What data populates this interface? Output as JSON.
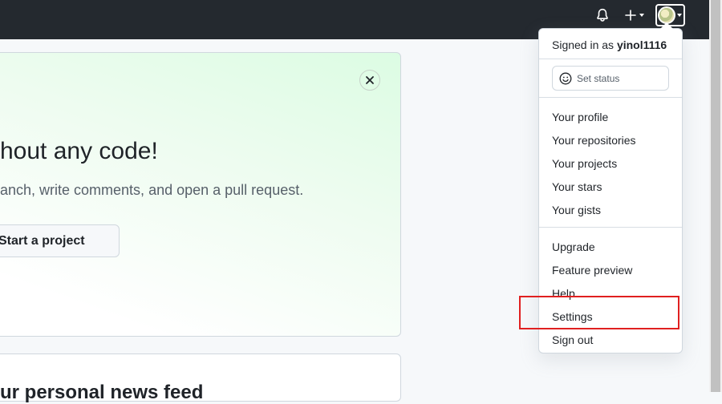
{
  "header": {
    "icons": [
      "bell-icon",
      "plus-icon",
      "avatar"
    ]
  },
  "banner": {
    "title": "hout any code!",
    "subtitle": "anch, write comments, and open a pull request.",
    "start_button": "Start a project"
  },
  "feed": {
    "title": "ur personal news feed"
  },
  "user_menu": {
    "signed_in_prefix": "Signed in as ",
    "username": "yinol1116",
    "set_status": "Set status",
    "group1": [
      "Your profile",
      "Your repositories",
      "Your projects",
      "Your stars",
      "Your gists"
    ],
    "group2": [
      "Upgrade",
      "Feature preview",
      "Help",
      "Settings",
      "Sign out"
    ]
  },
  "colors": {
    "topbar": "#24292f",
    "highlight": "#e02020"
  }
}
